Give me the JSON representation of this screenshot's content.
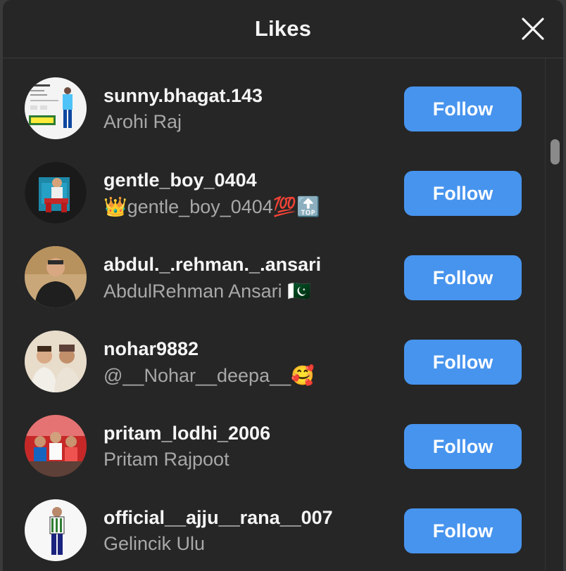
{
  "modal": {
    "title": "Likes",
    "close_icon": "close-icon"
  },
  "users": [
    {
      "username": "sunny.bhagat.143",
      "fullname": "Arohi Raj",
      "button": "Follow"
    },
    {
      "username": "gentle_boy_0404",
      "fullname": "👑gentle_boy_0404💯🔝",
      "button": "Follow"
    },
    {
      "username": "abdul._.rehman._.ansari",
      "fullname": "AbdulRehman Ansari 🇵🇰",
      "button": "Follow"
    },
    {
      "username": "nohar9882",
      "fullname": "@__Nohar__deepa__🥰",
      "button": "Follow"
    },
    {
      "username": "pritam_lodhi_2006",
      "fullname": "Pritam Rajpoot",
      "button": "Follow"
    },
    {
      "username": "official__ajju__rana__007",
      "fullname": "Gelincik Ulu",
      "button": "Follow"
    }
  ],
  "colors": {
    "background": "#262626",
    "follow_button": "#4794ee",
    "primary_text": "#f5f5f5",
    "secondary_text": "#a8a8a8"
  }
}
